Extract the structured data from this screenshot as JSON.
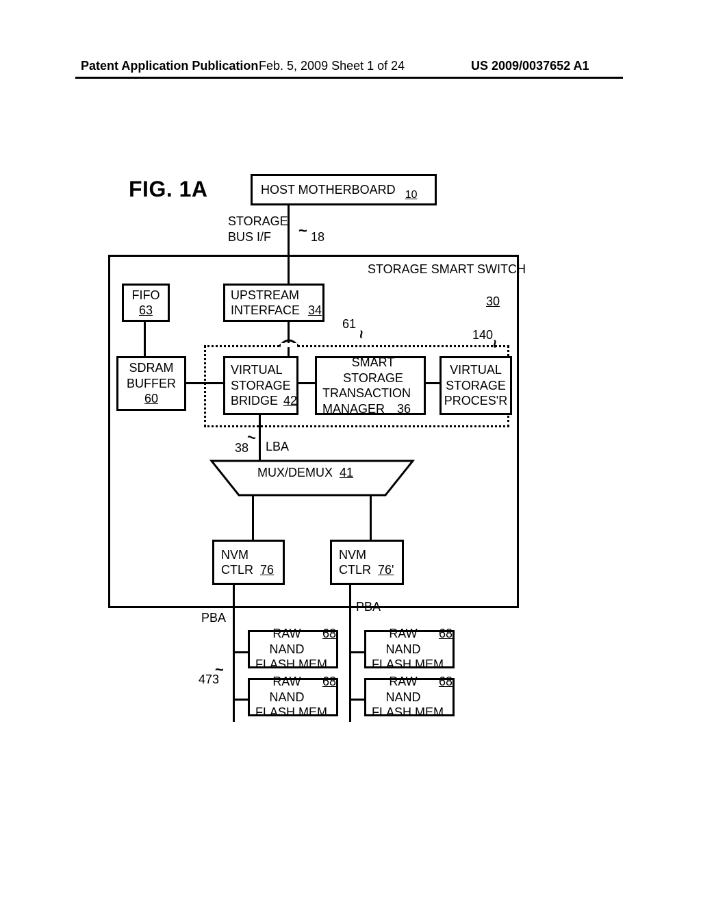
{
  "header": {
    "left": "Patent Application Publication",
    "middle": "Feb. 5, 2009  Sheet 1 of 24",
    "right": "US 2009/0037652 A1"
  },
  "figure_label": "FIG. 1A",
  "blocks": {
    "host": {
      "title": "HOST MOTHERBOARD",
      "ref": "10"
    },
    "storage_bus": {
      "l1": "STORAGE",
      "l2": "BUS I/F"
    },
    "bus_ref": "18",
    "switch_title": "STORAGE SMART SWITCH",
    "switch_ref": "30",
    "fifo": {
      "title": "FIFO",
      "ref": "63"
    },
    "upstream": {
      "l1": "UPSTREAM",
      "l2": "INTERFACE",
      "ref": "34"
    },
    "dashed_ref_left": "61",
    "dashed_ref_right": "140",
    "sdram": {
      "l1": "SDRAM",
      "l2": "BUFFER",
      "ref": "60"
    },
    "vsb": {
      "l1": "VIRTUAL",
      "l2": "STORAGE",
      "l3": "BRIDGE",
      "ref": "42"
    },
    "sstm": {
      "l1": "SMART STORAGE",
      "l2": "TRANSACTION",
      "l3": "MANAGER",
      "ref": "36"
    },
    "vsp": {
      "l1": "VIRTUAL",
      "l2": "STORAGE",
      "l3": "PROCES'R"
    },
    "lba_ref": "38",
    "lba_label": "LBA",
    "mux": {
      "title": "MUX/DEMUX",
      "ref": "41"
    },
    "nvm1": {
      "l1": "NVM",
      "l2": "CTLR",
      "ref": "76"
    },
    "nvm2": {
      "l1": "NVM",
      "l2": "CTLR",
      "ref": "76'"
    },
    "pba": "PBA",
    "raw_ref": "473",
    "nand": {
      "l1": "RAW NAND",
      "l2": "FLASH MEM",
      "ref": "68"
    }
  }
}
